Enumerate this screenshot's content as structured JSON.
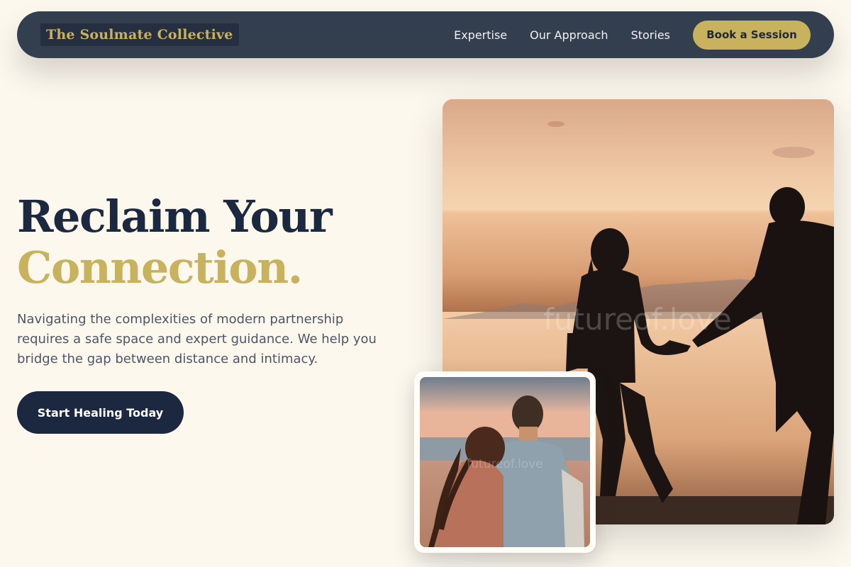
{
  "nav": {
    "logo": "The Soulmate Collective",
    "links": [
      "Expertise",
      "Our Approach",
      "Stories"
    ],
    "cta": "Book a Session"
  },
  "hero": {
    "title_line1": "Reclaim Your",
    "title_line2": "Connection.",
    "description": "Navigating the complexities of modern partnership requires a safe space and expert guidance. We help you bridge the gap between distance and intimacy.",
    "cta": "Start Healing Today"
  },
  "images": {
    "main_watermark": "futureof.love",
    "inset_watermark": "futureof.love"
  },
  "colors": {
    "background": "#fdf8ee",
    "navy": "#1c2840",
    "nav_bg": "#333e4f",
    "gold": "#c8b25c"
  }
}
